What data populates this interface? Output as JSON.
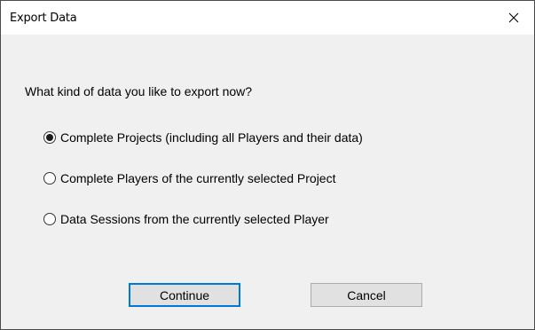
{
  "window": {
    "title": "Export Data"
  },
  "dialog": {
    "question": "What kind of data you like to export now?",
    "options": [
      {
        "label": "Complete Projects (including all Players and their data)",
        "selected": true
      },
      {
        "label": "Complete Players of the currently selected Project",
        "selected": false
      },
      {
        "label": "Data Sessions from the currently selected Player",
        "selected": false
      }
    ],
    "buttons": {
      "continue_label": "Continue",
      "cancel_label": "Cancel"
    }
  },
  "colors": {
    "background": "#f0f0f0",
    "titlebar": "#ffffff",
    "default_button_border": "#0078d7",
    "button_face": "#e1e1e1"
  },
  "icons": {
    "close": "close-icon"
  }
}
